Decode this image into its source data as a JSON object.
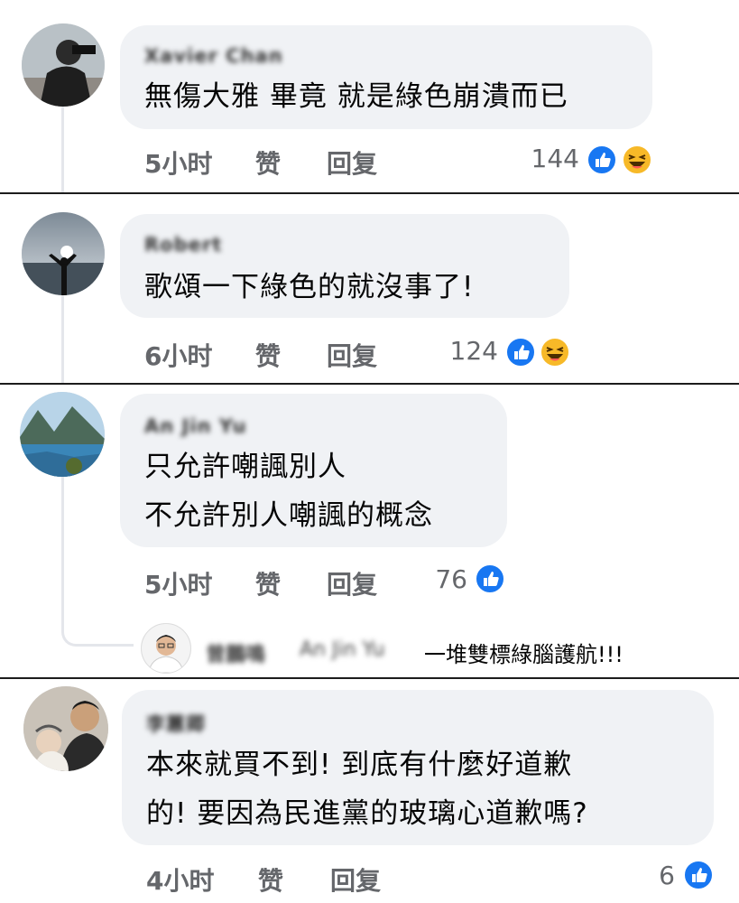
{
  "comments": [
    {
      "author": "Xavier Chan",
      "lines": [
        "無傷大雅 畢竟 就是綠色崩潰而已"
      ],
      "time": "5小时",
      "like_label": "赞",
      "reply_label": "回复",
      "reaction_count": "144",
      "reactions": [
        "like-icon",
        "haha-icon"
      ]
    },
    {
      "author": "Robert",
      "lines": [
        "歌頌一下綠色的就沒事了!"
      ],
      "time": "6小时",
      "like_label": "赞",
      "reply_label": "回复",
      "reaction_count": "124",
      "reactions": [
        "like-icon",
        "haha-icon"
      ]
    },
    {
      "author": "An Jin Yu",
      "lines": [
        "只允許嘲諷別人",
        "不允許別人嘲諷的概念"
      ],
      "time": "5小时",
      "like_label": "赞",
      "reply_label": "回复",
      "reaction_count": "76",
      "reactions": [
        "like-icon"
      ],
      "reply": {
        "author": "曾鵬鳴",
        "mention": "An Jin Yu",
        "text": "一堆雙標綠腦護航!!!"
      }
    },
    {
      "author": "李蕙卿",
      "lines": [
        "本來就買不到! 到底有什麼好道歉",
        "的! 要因為民進黨的玻璃心道歉嗎?"
      ],
      "time": "4小时",
      "like_label": "赞",
      "reply_label": "回复",
      "reaction_count": "6",
      "reactions": [
        "like-icon"
      ]
    }
  ],
  "colors": {
    "bubble": "#f0f2f5",
    "meta": "#65676b",
    "like": "#1877f2",
    "haha": "#f7b928",
    "divider": "#1c1c1c"
  }
}
